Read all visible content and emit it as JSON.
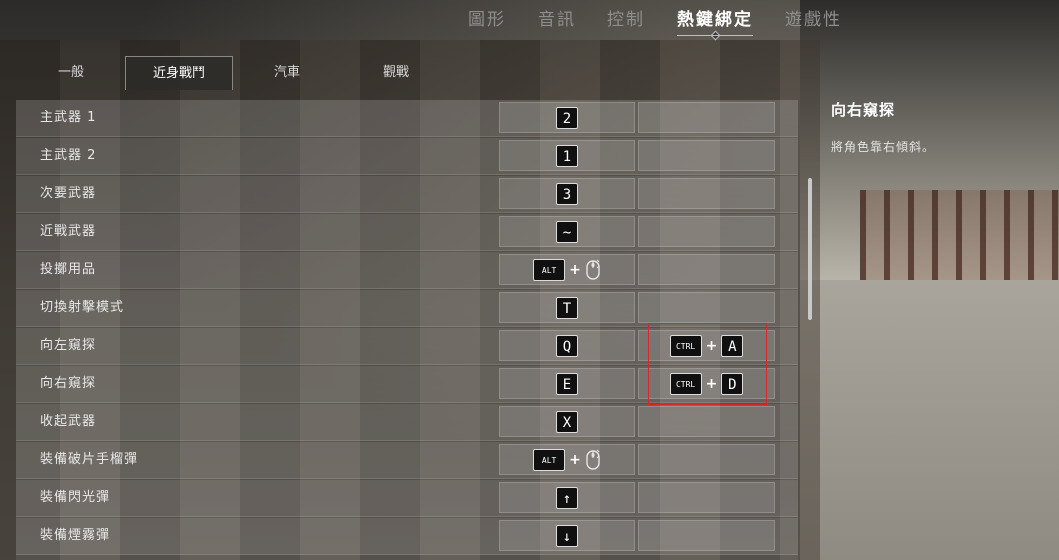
{
  "top_tabs": [
    {
      "label": "圖形",
      "active": false
    },
    {
      "label": "音訊",
      "active": false
    },
    {
      "label": "控制",
      "active": false
    },
    {
      "label": "熱鍵綁定",
      "active": true
    },
    {
      "label": "遊戲性",
      "active": false
    }
  ],
  "sub_tabs": [
    {
      "label": "一般",
      "active": false
    },
    {
      "label": "近身戰鬥",
      "active": true
    },
    {
      "label": "汽車",
      "active": false
    },
    {
      "label": "觀戰",
      "active": false
    }
  ],
  "bindings": [
    {
      "label": "主武器 1",
      "primary": {
        "key": "2"
      },
      "secondary": null
    },
    {
      "label": "主武器 2",
      "primary": {
        "key": "1"
      },
      "secondary": null
    },
    {
      "label": "次要武器",
      "primary": {
        "key": "3"
      },
      "secondary": null
    },
    {
      "label": "近戰武器",
      "primary": {
        "key": "~"
      },
      "secondary": null
    },
    {
      "label": "投擲用品",
      "primary": {
        "modifier": "ALT",
        "mouse": "scroll-wheel-icon"
      },
      "secondary": null
    },
    {
      "label": "切換射擊模式",
      "primary": {
        "key": "T"
      },
      "secondary": null
    },
    {
      "label": "向左窺探",
      "primary": {
        "key": "Q"
      },
      "secondary": {
        "modifier": "CTRL",
        "key": "A"
      }
    },
    {
      "label": "向右窺探",
      "primary": {
        "key": "E"
      },
      "secondary": {
        "modifier": "CTRL",
        "key": "D"
      }
    },
    {
      "label": "收起武器",
      "primary": {
        "key": "X"
      },
      "secondary": null
    },
    {
      "label": "裝備破片手榴彈",
      "primary": {
        "modifier": "ALT",
        "mouse": "scroll-wheel-icon"
      },
      "secondary": null
    },
    {
      "label": "裝備閃光彈",
      "primary": {
        "key": "↑"
      },
      "secondary": null
    },
    {
      "label": "裝備煙霧彈",
      "primary": {
        "key": "↓"
      },
      "secondary": null
    }
  ],
  "plus_sign": "+",
  "description": {
    "title": "向右窺探",
    "text": "將角色靠右傾斜。"
  },
  "colors": {
    "highlight": "#d22a2a",
    "active_tab": "#ffffff",
    "inactive_tab": "#8e8e8e"
  }
}
